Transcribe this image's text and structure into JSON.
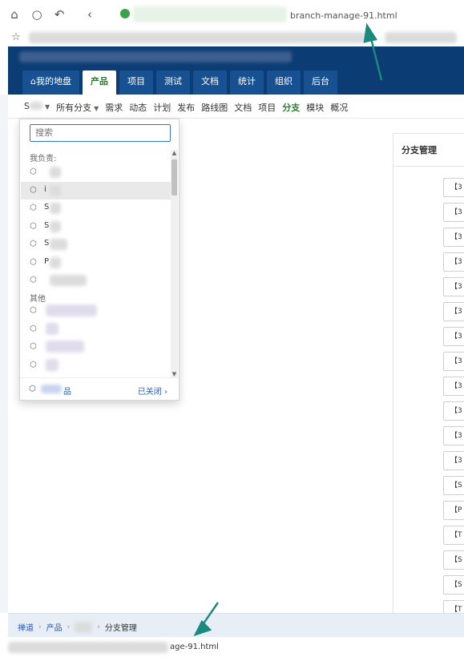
{
  "browser": {
    "url_suffix": "branch-manage-91.html",
    "status_url_suffix": "age-91.html"
  },
  "header": {
    "tabs": [
      {
        "label": "我的地盘",
        "icon": "home-icon"
      },
      {
        "label": "产品",
        "active": true
      },
      {
        "label": "项目"
      },
      {
        "label": "测试"
      },
      {
        "label": "文档"
      },
      {
        "label": "统计"
      },
      {
        "label": "组织"
      },
      {
        "label": "后台"
      }
    ]
  },
  "subnav": {
    "product_selector": "S",
    "items": [
      "所有分支",
      "需求",
      "动态",
      "计划",
      "发布",
      "路线图",
      "文档",
      "项目",
      "分支",
      "模块",
      "概况"
    ],
    "active": "分支"
  },
  "dropdown": {
    "search_placeholder": "搜索",
    "group_mine": "我负责:",
    "group_other": "其他",
    "mine_items": [
      "",
      "i",
      "S",
      "S",
      "S",
      "P",
      ""
    ],
    "other_items": [
      "",
      "",
      "",
      ""
    ],
    "footer_item": "品",
    "closed_label": "已关闭"
  },
  "right_panel": {
    "title": "分支管理",
    "button_prefixes": [
      "【3",
      "【3",
      "【3",
      "【3",
      "【3",
      "【3",
      "【3",
      "【3",
      "【3",
      "【3",
      "【3",
      "【3",
      "【S",
      "【P",
      "【T",
      "【S",
      "【S",
      "【T"
    ]
  },
  "breadcrumb": {
    "items": [
      "禅道",
      "产品",
      "",
      "分支管理"
    ]
  },
  "colors": {
    "header_bg": "#0c3c74",
    "tab_bg": "#175192",
    "active_green": "#2a7a2f",
    "link_blue": "#2c5bb0",
    "annotation_arrow": "#1a8a7f"
  }
}
